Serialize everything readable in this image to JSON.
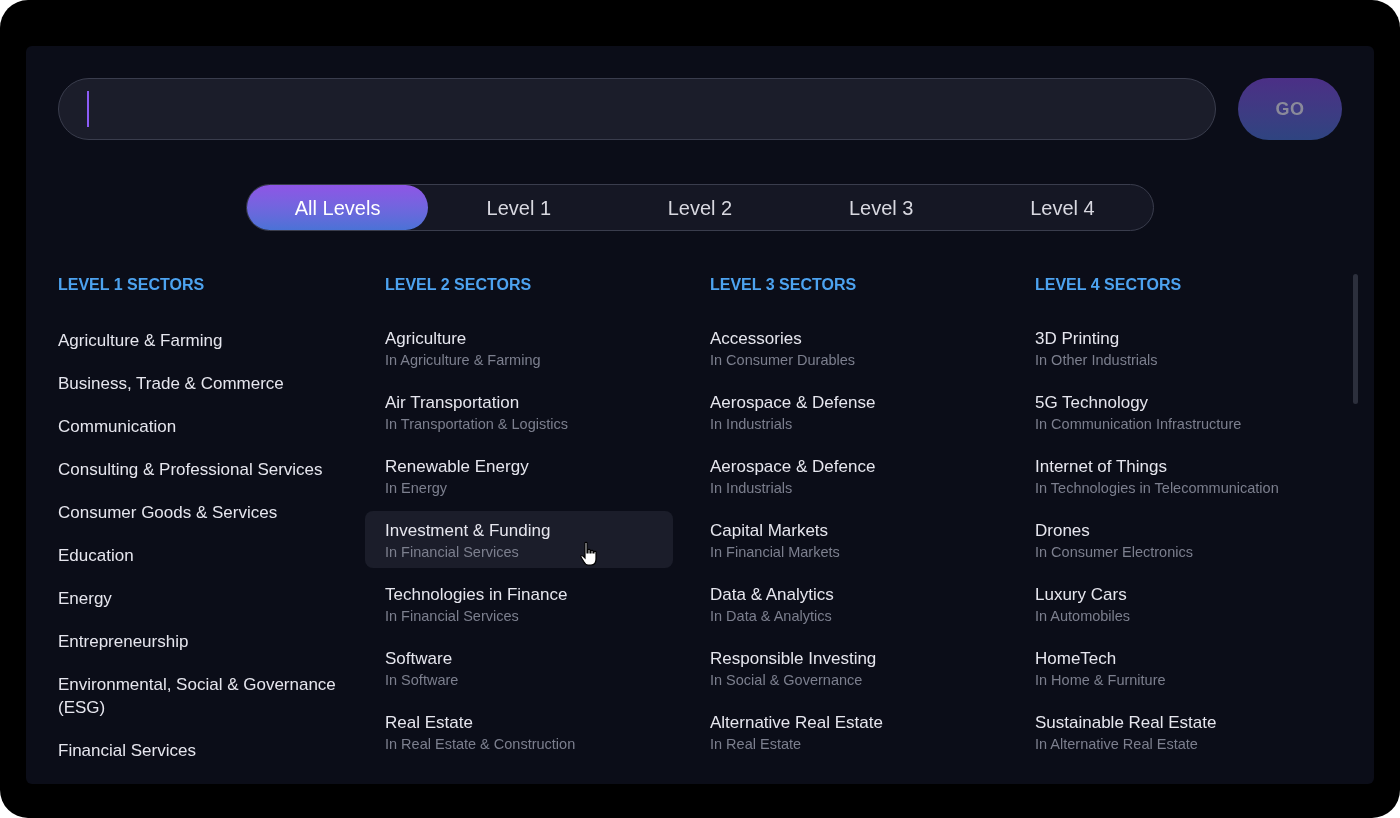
{
  "search": {
    "button": "GO"
  },
  "tabs": [
    {
      "label": "All Levels",
      "selected": true
    },
    {
      "label": "Level 1",
      "selected": false
    },
    {
      "label": "Level 2",
      "selected": false
    },
    {
      "label": "Level 3",
      "selected": false
    },
    {
      "label": "Level 4",
      "selected": false
    }
  ],
  "columns": [
    {
      "heading": "LEVEL 1 SECTORS",
      "items": [
        {
          "name": "Agriculture & Farming",
          "highlighted": false
        },
        {
          "name": "Business, Trade & Commerce",
          "highlighted": false
        },
        {
          "name": "Communication",
          "highlighted": false
        },
        {
          "name": "Consulting & Professional Services",
          "highlighted": false
        },
        {
          "name": "Consumer Goods & Services",
          "highlighted": false
        },
        {
          "name": "Education",
          "highlighted": false
        },
        {
          "name": "Energy",
          "highlighted": false
        },
        {
          "name": "Entrepreneurship",
          "highlighted": false
        },
        {
          "name": "Environmental, Social & Governance (ESG)",
          "highlighted": false
        },
        {
          "name": "Financial Services",
          "highlighted": false
        }
      ]
    },
    {
      "heading": "LEVEL 2 SECTORS",
      "items": [
        {
          "name": "Agriculture",
          "parent": "In Agriculture & Farming",
          "highlighted": false
        },
        {
          "name": "Air Transportation",
          "parent": "In Transportation & Logistics",
          "highlighted": false
        },
        {
          "name": "Renewable Energy",
          "parent": "In Energy",
          "highlighted": false
        },
        {
          "name": "Investment & Funding",
          "parent": "In Financial Services",
          "highlighted": true
        },
        {
          "name": "Technologies in Finance",
          "parent": "In Financial Services",
          "highlighted": false
        },
        {
          "name": "Software",
          "parent": "In Software",
          "highlighted": false
        },
        {
          "name": "Real Estate",
          "parent": "In Real Estate & Construction",
          "highlighted": false
        }
      ]
    },
    {
      "heading": "LEVEL 3 SECTORS",
      "items": [
        {
          "name": "Accessories",
          "parent": "In Consumer Durables",
          "highlighted": false
        },
        {
          "name": "Aerospace & Defense",
          "parent": "In Industrials",
          "highlighted": false
        },
        {
          "name": "Aerospace & Defence",
          "parent": "In Industrials",
          "highlighted": false
        },
        {
          "name": "Capital Markets",
          "parent": "In Financial Markets",
          "highlighted": false
        },
        {
          "name": "Data & Analytics",
          "parent": "In Data & Analytics",
          "highlighted": false
        },
        {
          "name": "Responsible Investing",
          "parent": "In Social & Governance",
          "highlighted": false
        },
        {
          "name": "Alternative Real Estate",
          "parent": "In Real Estate",
          "highlighted": false
        }
      ]
    },
    {
      "heading": "LEVEL 4 SECTORS",
      "items": [
        {
          "name": "3D Printing",
          "parent": "In Other Industrials",
          "highlighted": false
        },
        {
          "name": "5G Technology",
          "parent": "In Communication Infrastructure",
          "highlighted": false
        },
        {
          "name": "Internet of Things",
          "parent": "In Technologies in Telecommunication",
          "highlighted": false
        },
        {
          "name": "Drones",
          "parent": "In Consumer Electronics",
          "highlighted": false
        },
        {
          "name": "Luxury Cars",
          "parent": "In Automobiles",
          "highlighted": false
        },
        {
          "name": "HomeTech",
          "parent": "In Home & Furniture",
          "highlighted": false
        },
        {
          "name": "Sustainable Real Estate",
          "parent": "In Alternative Real Estate",
          "highlighted": false
        }
      ]
    }
  ]
}
